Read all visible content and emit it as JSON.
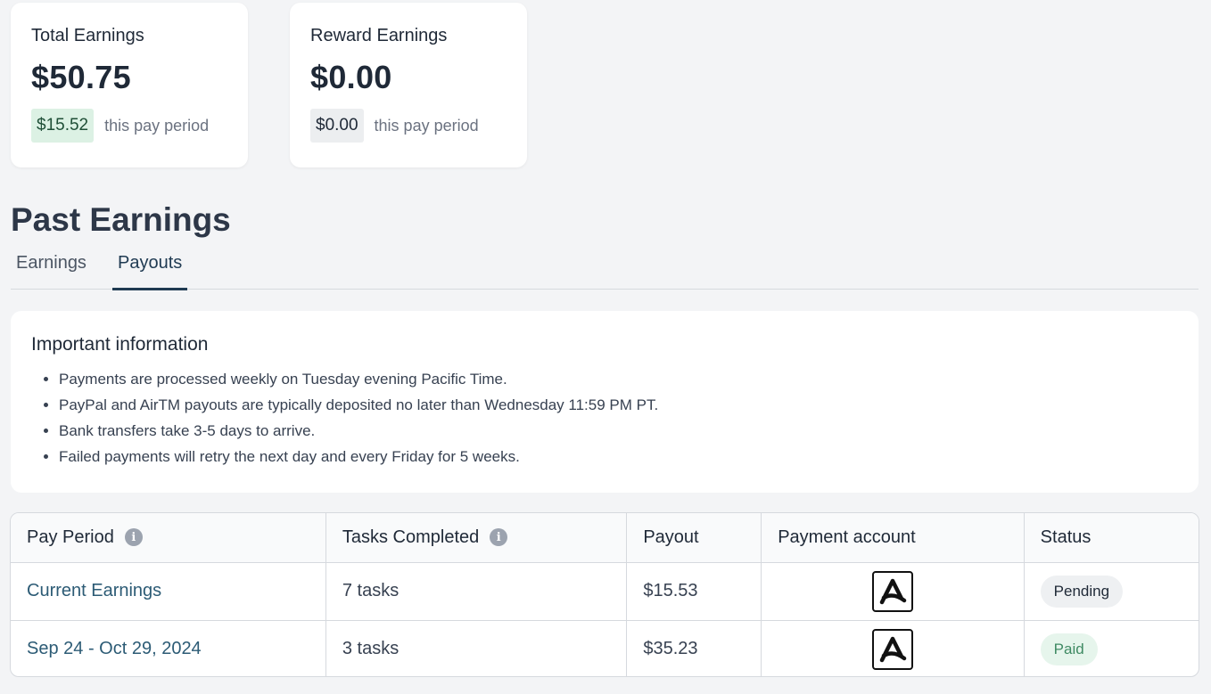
{
  "cards": {
    "total": {
      "title": "Total Earnings",
      "amount": "$50.75",
      "period_amount": "$15.52",
      "period_label": "this pay period"
    },
    "reward": {
      "title": "Reward Earnings",
      "amount": "$0.00",
      "period_amount": "$0.00",
      "period_label": "this pay period"
    }
  },
  "section_title": "Past Earnings",
  "tabs": [
    {
      "label": "Earnings"
    },
    {
      "label": "Payouts",
      "active": true
    }
  ],
  "info": {
    "title": "Important information",
    "items": [
      "Payments are processed weekly on Tuesday evening Pacific Time.",
      "PayPal and AirTM payouts are typically deposited no later than Wednesday 11:59 PM PT.",
      "Bank transfers take 3-5 days to arrive.",
      "Failed payments will retry the next day and every Friday for 5 weeks."
    ]
  },
  "table": {
    "headers": [
      "Pay Period",
      "Tasks Completed",
      "Payout",
      "Payment account",
      "Status"
    ],
    "rows": [
      {
        "period": "Current Earnings",
        "tasks": "7 tasks",
        "payout": "$15.53",
        "account_icon": "airtm-logo-icon",
        "status": "Pending"
      },
      {
        "period": "Sep 24 - Oct 29, 2024",
        "tasks": "3 tasks",
        "payout": "$35.23",
        "account_icon": "airtm-logo-icon",
        "status": "Paid"
      }
    ]
  },
  "colors": {
    "accent": "#1f3a52",
    "link": "#2c5b75",
    "paid_green": "#3f8a63",
    "period_green_bg": "#dcf1e4"
  }
}
